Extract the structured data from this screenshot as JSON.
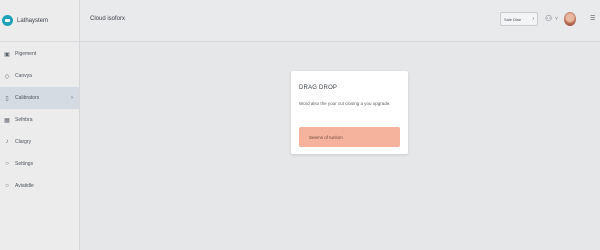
{
  "app": {
    "name": "Lathaystem"
  },
  "sidebar": {
    "items": [
      {
        "label": "Pigement",
        "icon": "box-icon"
      },
      {
        "label": "Canvya",
        "icon": "layers-icon"
      },
      {
        "label": "Calibrators",
        "icon": "book-icon",
        "active": true
      },
      {
        "label": "Sefnbra",
        "icon": "grid-icon"
      },
      {
        "label": "Clargry",
        "icon": "rocket-icon"
      },
      {
        "label": "Settings",
        "icon": "gear-icon"
      },
      {
        "label": "Aviatidle",
        "icon": "circle-icon"
      }
    ]
  },
  "header": {
    "title": "Cloud isoforx",
    "action_label": "Sale Dise"
  },
  "card": {
    "title": "DRAG DROP",
    "description": "Word also the your cut closing a you upgrade.",
    "cta_label": "Seems of tunlom"
  }
}
